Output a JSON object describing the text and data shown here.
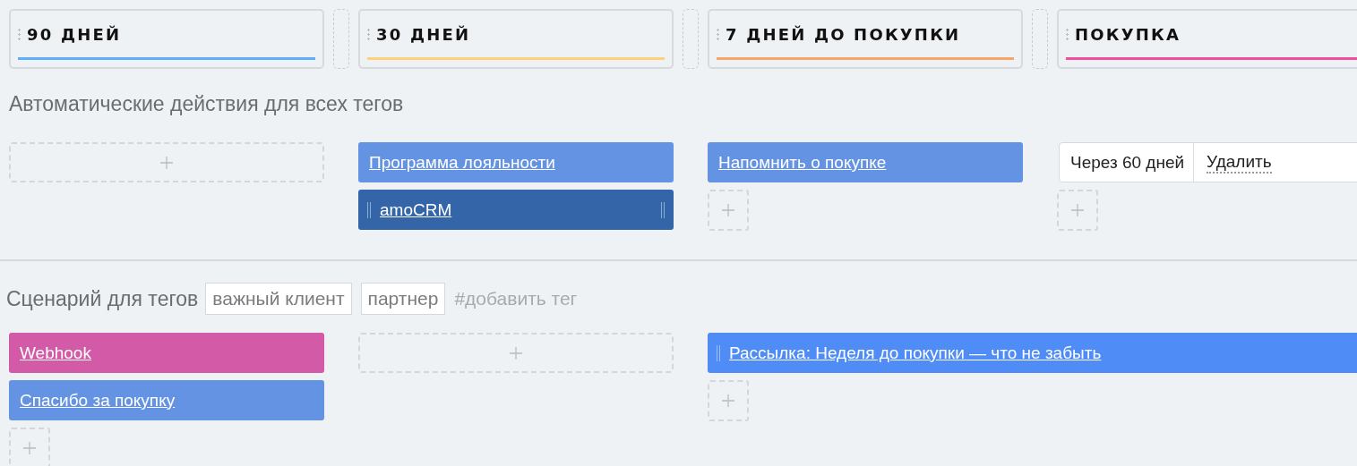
{
  "stages": [
    {
      "title": "90 ДНЕЙ",
      "color": "#5eaefc"
    },
    {
      "title": "30 ДНЕЙ",
      "color": "#fdd27a"
    },
    {
      "title": "7 ДНЕЙ ДО ПОКУПКИ",
      "color": "#f7a66a"
    },
    {
      "title": "ПОКУПКА",
      "color": "#ee4f9c"
    }
  ],
  "auto_actions": {
    "title": "Автоматические действия для всех тегов",
    "columns": [
      {
        "wide": false,
        "items": [
          {
            "kind": "dropzone"
          }
        ]
      },
      {
        "wide": false,
        "items": [
          {
            "kind": "card",
            "label": "Программа лояльности",
            "color": "#6593e3",
            "left_handle": false,
            "right_handle": false
          },
          {
            "kind": "card",
            "label": "amoCRM",
            "color": "#3465a8",
            "left_handle": true,
            "right_handle": true
          }
        ]
      },
      {
        "wide": false,
        "items": [
          {
            "kind": "card",
            "label": "Напомнить о покупке",
            "color": "#6593e3",
            "left_handle": false,
            "right_handle": false
          },
          {
            "kind": "add"
          }
        ]
      },
      {
        "items": [
          {
            "kind": "rule",
            "delay": "Через 60 дней",
            "action": "Удалить"
          },
          {
            "kind": "add"
          }
        ]
      }
    ]
  },
  "scenario": {
    "title": "Сценарий для тегов",
    "tags": [
      "важный клиент",
      "партнер"
    ],
    "placeholder": "#добавить тег",
    "columns": [
      {
        "wide": false,
        "items": [
          {
            "kind": "card",
            "label": "Webhook",
            "color": "#d35aa6",
            "left_handle": false,
            "right_handle": false
          },
          {
            "kind": "card",
            "label": "Спасибо за покупку",
            "color": "#6593e3",
            "left_handle": false,
            "right_handle": false
          },
          {
            "kind": "add"
          }
        ]
      },
      {
        "wide": false,
        "items": [
          {
            "kind": "dropzone"
          }
        ]
      },
      {
        "wide": true,
        "items": [
          {
            "kind": "card",
            "label": "Рассылка: Неделя до покупки — что не забыть",
            "color": "#4f8cf6",
            "left_handle": true,
            "right_handle": false
          },
          {
            "kind": "add"
          }
        ]
      }
    ]
  }
}
